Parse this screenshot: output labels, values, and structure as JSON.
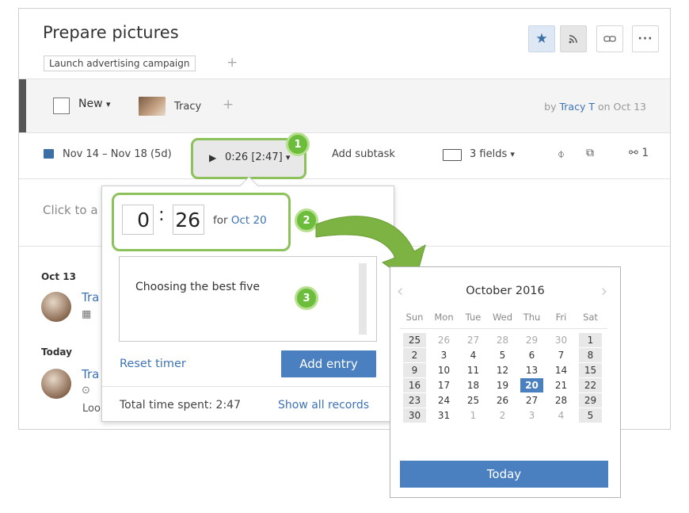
{
  "task": {
    "title": "Prepare pictures",
    "folder_tag": "Launch advertising campaign",
    "add_tag": "+",
    "status": "New",
    "status_caret": "▾",
    "assignee": "Tracy",
    "add_assignee": "+",
    "author_prefix": "by",
    "author_name": "Tracy T",
    "author_suffix": "on Oct 13",
    "description_placeholder": "Click to a",
    "toolbar_icons": [
      "star-icon",
      "rss-icon",
      "link-icon",
      "more-icon"
    ]
  },
  "toolbar_row": {
    "dates": "Nov 14 – Nov 18 (5d)",
    "timer_value": "0:26 [2:47]",
    "timer_caret": "▾",
    "subtask": "Add subtask",
    "fields": "3 fields",
    "fields_caret": "▾",
    "share_count": "1"
  },
  "stream": {
    "date1": "Oct 13",
    "name1": "Tra",
    "date2": "Today",
    "name2": "Tra",
    "fragment": "Loo"
  },
  "callouts": [
    "1",
    "2",
    "3"
  ],
  "timer_popup": {
    "hours": "0",
    "colon": ":",
    "minutes": "26",
    "for_prefix": "for",
    "for_date": "Oct 20",
    "note": "Choosing the best five",
    "reset": "Reset timer",
    "add_entry": "Add entry",
    "total_label": "Total time spent: 2:47",
    "show_all": "Show all records"
  },
  "calendar": {
    "title": "October 2016",
    "prev": "‹",
    "next": "›",
    "days": [
      "Sun",
      "Mon",
      "Tue",
      "Wed",
      "Thu",
      "Fri",
      "Sat"
    ],
    "weeks": [
      [
        {
          "d": "25",
          "out": false,
          "wk": true
        },
        {
          "d": "26",
          "out": true
        },
        {
          "d": "27",
          "out": true
        },
        {
          "d": "28",
          "out": true
        },
        {
          "d": "29",
          "out": true
        },
        {
          "d": "30",
          "out": true
        },
        {
          "d": "1",
          "wk": true
        }
      ],
      [
        {
          "d": "2",
          "wk": true
        },
        {
          "d": "3"
        },
        {
          "d": "4"
        },
        {
          "d": "5"
        },
        {
          "d": "6"
        },
        {
          "d": "7"
        },
        {
          "d": "8",
          "wk": true
        }
      ],
      [
        {
          "d": "9",
          "wk": true
        },
        {
          "d": "10"
        },
        {
          "d": "11"
        },
        {
          "d": "12"
        },
        {
          "d": "13"
        },
        {
          "d": "14"
        },
        {
          "d": "15",
          "wk": true
        }
      ],
      [
        {
          "d": "16",
          "wk": true
        },
        {
          "d": "17"
        },
        {
          "d": "18"
        },
        {
          "d": "19"
        },
        {
          "d": "20",
          "sel": true
        },
        {
          "d": "21"
        },
        {
          "d": "22",
          "wk": true
        }
      ],
      [
        {
          "d": "23",
          "wk": true
        },
        {
          "d": "24"
        },
        {
          "d": "25"
        },
        {
          "d": "26"
        },
        {
          "d": "27"
        },
        {
          "d": "28"
        },
        {
          "d": "29",
          "wk": true
        }
      ],
      [
        {
          "d": "30",
          "wk": true
        },
        {
          "d": "31"
        },
        {
          "d": "1",
          "out": true
        },
        {
          "d": "2",
          "out": true
        },
        {
          "d": "3",
          "out": true
        },
        {
          "d": "4",
          "out": true
        },
        {
          "d": "5",
          "wk": true
        }
      ]
    ],
    "today_button": "Today"
  },
  "colors": {
    "accent_blue": "#4a80c0",
    "link_blue": "#3d73b5",
    "callout_green": "#6dbd3d",
    "highlight_green": "#8dc15c"
  }
}
